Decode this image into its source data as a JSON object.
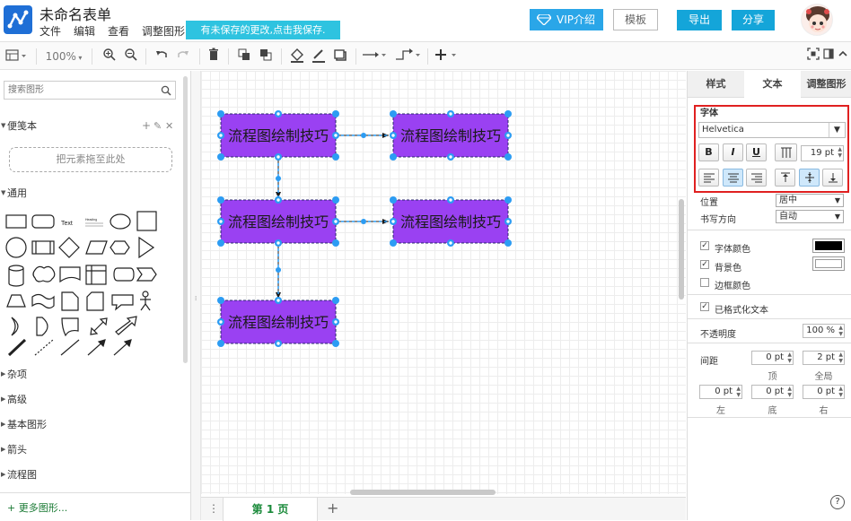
{
  "app": {
    "title": "未命名表单",
    "menu": [
      "文件",
      "编辑",
      "查看",
      "调整图形"
    ],
    "save_banner": "有未保存的更改,点击我保存.",
    "vip_label": "VIP介绍",
    "template_label": "模板",
    "export_label": "导出",
    "share_label": "分享"
  },
  "toolbar": {
    "zoom": "100%"
  },
  "left_panel": {
    "search_placeholder": "搜索图形",
    "scratchpad_title": "便笺本",
    "drop_hint": "把元素拖至此处",
    "general_title": "通用",
    "shape_text_label": "Text",
    "shape_heading_label": "Heading",
    "sections": [
      "杂项",
      "高级",
      "基本图形",
      "箭头",
      "流程图"
    ],
    "more_shapes": "+ 更多图形..."
  },
  "diagram": {
    "node_label": "流程图绘制技巧",
    "node_fill": "#9a41f2",
    "handle_color": "#2c9cf3",
    "nodes": [
      "node-1",
      "node-2",
      "node-3",
      "node-4",
      "node-5"
    ]
  },
  "pages": {
    "current": "第 1 页"
  },
  "right_panel": {
    "tabs": [
      "样式",
      "文本",
      "调整图形"
    ],
    "font_section": "字体",
    "font_family": "Helvetica",
    "bold": "B",
    "italic": "I",
    "underline": "U",
    "font_size": "19 pt",
    "position_label": "位置",
    "position_value": "居中",
    "direction_label": "书写方向",
    "direction_value": "自动",
    "font_color_label": "字体颜色",
    "font_color": "#000000",
    "bg_color_label": "背景色",
    "bg_color": "#ffffff",
    "border_color_label": "边框颜色",
    "formatted_text_label": "已格式化文本",
    "opacity_label": "不透明度",
    "opacity_value": "100 %",
    "spacing_label": "间距",
    "spacing_top": "0 pt",
    "spacing_global": "2 pt",
    "spacing_top_label": "顶",
    "spacing_global_label": "全局",
    "spacing_left": "0 pt",
    "spacing_bottom": "0 pt",
    "spacing_right": "0 pt",
    "spacing_left_label": "左",
    "spacing_bottom_label": "底",
    "spacing_right_label": "右",
    "highlight_color": "#e02020"
  }
}
